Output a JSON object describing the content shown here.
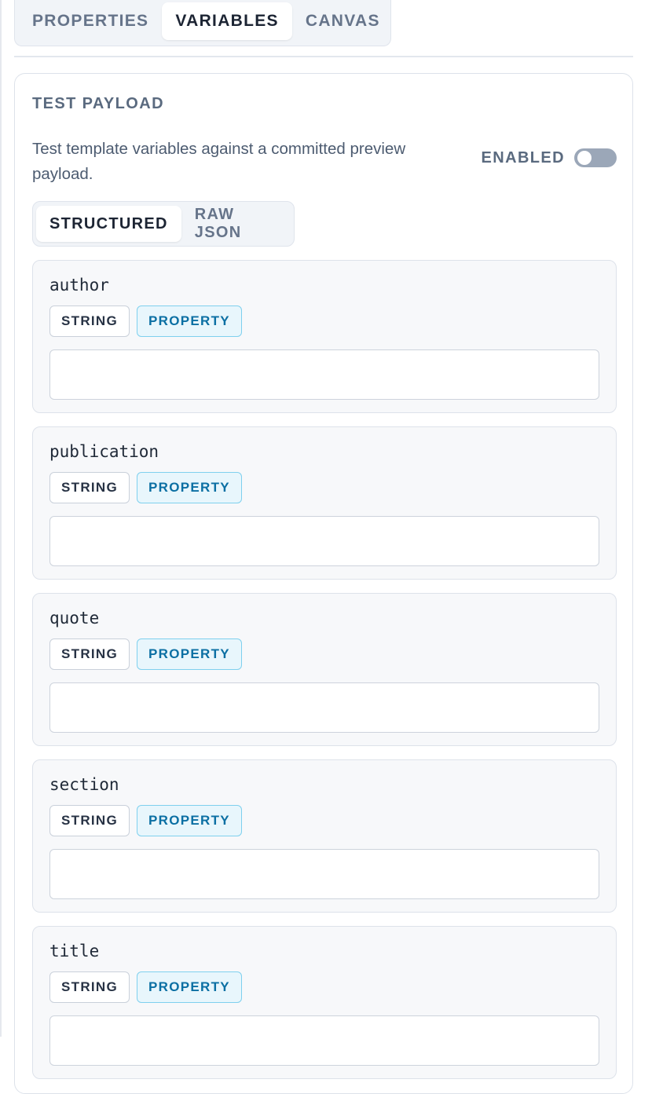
{
  "tabs": [
    {
      "label": "PROPERTIES",
      "active": false
    },
    {
      "label": "VARIABLES",
      "active": true
    },
    {
      "label": "CANVAS",
      "active": false
    }
  ],
  "payload": {
    "title": "TEST PAYLOAD",
    "description": "Test template variables against a committed preview payload.",
    "enabled_label": "ENABLED",
    "enabled": false,
    "modes": [
      {
        "label": "STRUCTURED",
        "active": true
      },
      {
        "label": "RAW JSON",
        "active": false
      }
    ]
  },
  "variables": [
    {
      "name": "author",
      "type": "STRING",
      "kind": "PROPERTY",
      "value": ""
    },
    {
      "name": "publication",
      "type": "STRING",
      "kind": "PROPERTY",
      "value": ""
    },
    {
      "name": "quote",
      "type": "STRING",
      "kind": "PROPERTY",
      "value": ""
    },
    {
      "name": "section",
      "type": "STRING",
      "kind": "PROPERTY",
      "value": ""
    },
    {
      "name": "title",
      "type": "STRING",
      "kind": "PROPERTY",
      "value": ""
    }
  ],
  "colors": {
    "accent_badge_text": "#0b6fa3",
    "accent_badge_bg": "#e8f6fc",
    "toggle_off": "#9ba7b8"
  }
}
